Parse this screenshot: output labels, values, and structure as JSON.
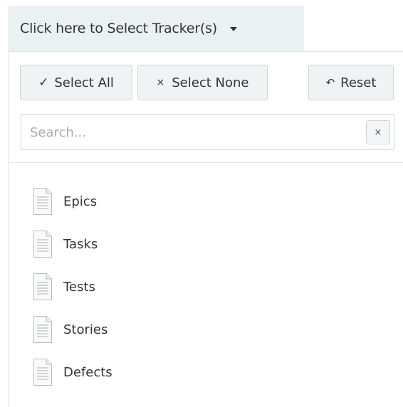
{
  "trigger": {
    "label": "Click here to Select Tracker(s)"
  },
  "toolbar": {
    "select_all_glyph": "✓",
    "select_all_label": "Select All",
    "select_none_glyph": "×",
    "select_none_label": "Select None",
    "reset_glyph": "↶",
    "reset_label": "Reset"
  },
  "search": {
    "placeholder": "Search...",
    "value": "",
    "clear_glyph": "×"
  },
  "trackers": [
    {
      "label": "Epics",
      "icon": "document-icon"
    },
    {
      "label": "Tasks",
      "icon": "document-icon"
    },
    {
      "label": "Tests",
      "icon": "document-icon"
    },
    {
      "label": "Stories",
      "icon": "document-icon"
    },
    {
      "label": "Defects",
      "icon": "document-icon"
    }
  ]
}
